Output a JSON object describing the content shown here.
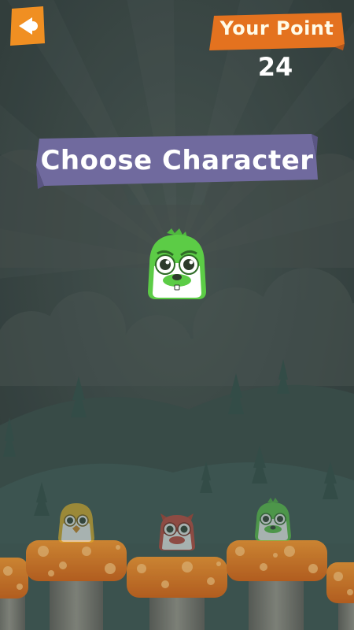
{
  "hud": {
    "points_label": "Your Point",
    "points_value": "24"
  },
  "title": "Choose Character",
  "colors": {
    "back_button": "#f08f22",
    "points_banner": "#e4721f",
    "title_banner": "#706a9e",
    "background_dark": "#3b4a47",
    "hill_teal": "#3f5a55",
    "mushroom_cap": "#e28a2a",
    "mushroom_stem": "#7a7d73"
  },
  "icons": {
    "back": "back-arrow-icon"
  },
  "characters": {
    "selected": "green-monster",
    "options": [
      "yellow-bird",
      "red-owl",
      "green-monster"
    ]
  }
}
